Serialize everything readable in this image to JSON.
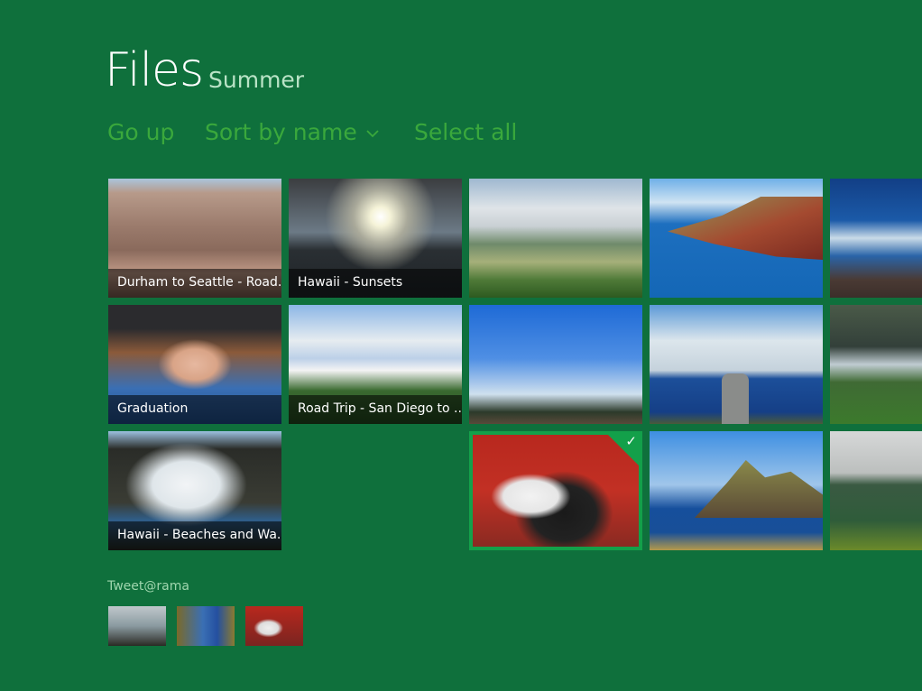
{
  "header": {
    "title": "Files",
    "subtitle": "Summer"
  },
  "commands": {
    "go_up": "Go up",
    "sort": "Sort by name",
    "select_all": "Select all"
  },
  "tiles": [
    {
      "caption": "Durham to Seattle - Road...",
      "selected": false
    },
    {
      "caption": "Hawaii - Sunsets",
      "selected": false
    },
    {
      "caption": "",
      "selected": false
    },
    {
      "caption": "",
      "selected": false
    },
    {
      "caption": "",
      "selected": false
    },
    {
      "caption": "Graduation",
      "selected": false
    },
    {
      "caption": "Road Trip - San Diego to ...",
      "selected": false
    },
    {
      "caption": "",
      "selected": false
    },
    {
      "caption": "",
      "selected": false
    },
    {
      "caption": "",
      "selected": false
    },
    {
      "caption": "Hawaii - Beaches and Wa...",
      "selected": false
    },
    {
      "caption": "",
      "selected": true
    },
    {
      "caption": "",
      "selected": false
    },
    {
      "caption": "",
      "selected": false
    }
  ],
  "share": {
    "label": "Tweet@rama",
    "thumbnails": [
      "palm-trees-photo",
      "graduation-photo",
      "panda-photo"
    ]
  },
  "check_glyph": "✓",
  "accent": "#13a04a",
  "background": "#0f703c"
}
